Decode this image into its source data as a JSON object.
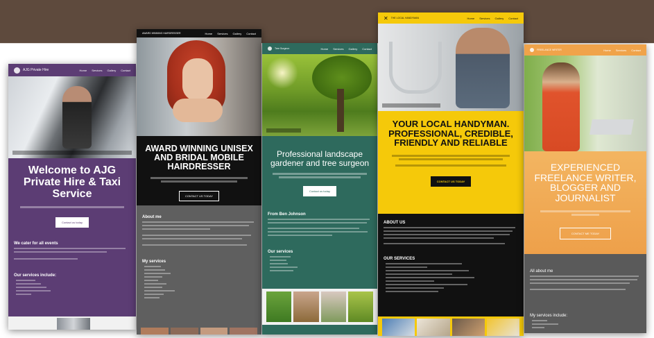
{
  "cards": {
    "taxi": {
      "brand": "AJG Private Hire",
      "menu": [
        "Home",
        "Services",
        "Gallery",
        "Contact"
      ],
      "headline": "Welcome to AJG Private Hire & Taxi Service",
      "cta": "Contact us today",
      "section1": "We cater for all events",
      "section2": "Our services include:",
      "accent": "#5c3d74"
    },
    "hairdresser": {
      "brand": "AWARD WINNING HAIRDRESSER",
      "menu": [
        "Home",
        "Services",
        "Gallery",
        "Contact"
      ],
      "headline": "AWARD WINNING UNISEX AND BRIDAL MOBILE HAIRDRESSER",
      "cta": "CONTACT US TODAY",
      "section1": "About me",
      "section2": "My services",
      "accent": "#111111"
    },
    "landscape": {
      "brand": "Tree Surgeon",
      "menu": [
        "Home",
        "Services",
        "Gallery",
        "Contact"
      ],
      "headline": "Professional landscape gardener and tree surgeon",
      "cta": "Contact us today",
      "section1": "From Ben Johnson",
      "section2": "Our services",
      "accent": "#2e6a5d"
    },
    "handyman": {
      "brand": "THE LOCAL HANDYMAN",
      "menu": [
        "Home",
        "Services",
        "Gallery",
        "Contact"
      ],
      "headline": "YOUR LOCAL HANDYMAN. PROFESSIONAL, CREDIBLE, FRIENDLY AND RELIABLE",
      "cta": "CONTACT US TODAY",
      "section1": "ABOUT US",
      "section2": "OUR SERVICES",
      "accent": "#f5c90a"
    },
    "writer": {
      "brand": "FREELANCE WRITER",
      "menu": [
        "Home",
        "Services",
        "Contact"
      ],
      "headline": "EXPERIENCED FREELANCE WRITER, BLOGGER AND JOURNALIST",
      "cta": "CONTACT ME TODAY",
      "section1": "All about me",
      "section2": "My services include:",
      "accent": "#f0a34a"
    }
  }
}
